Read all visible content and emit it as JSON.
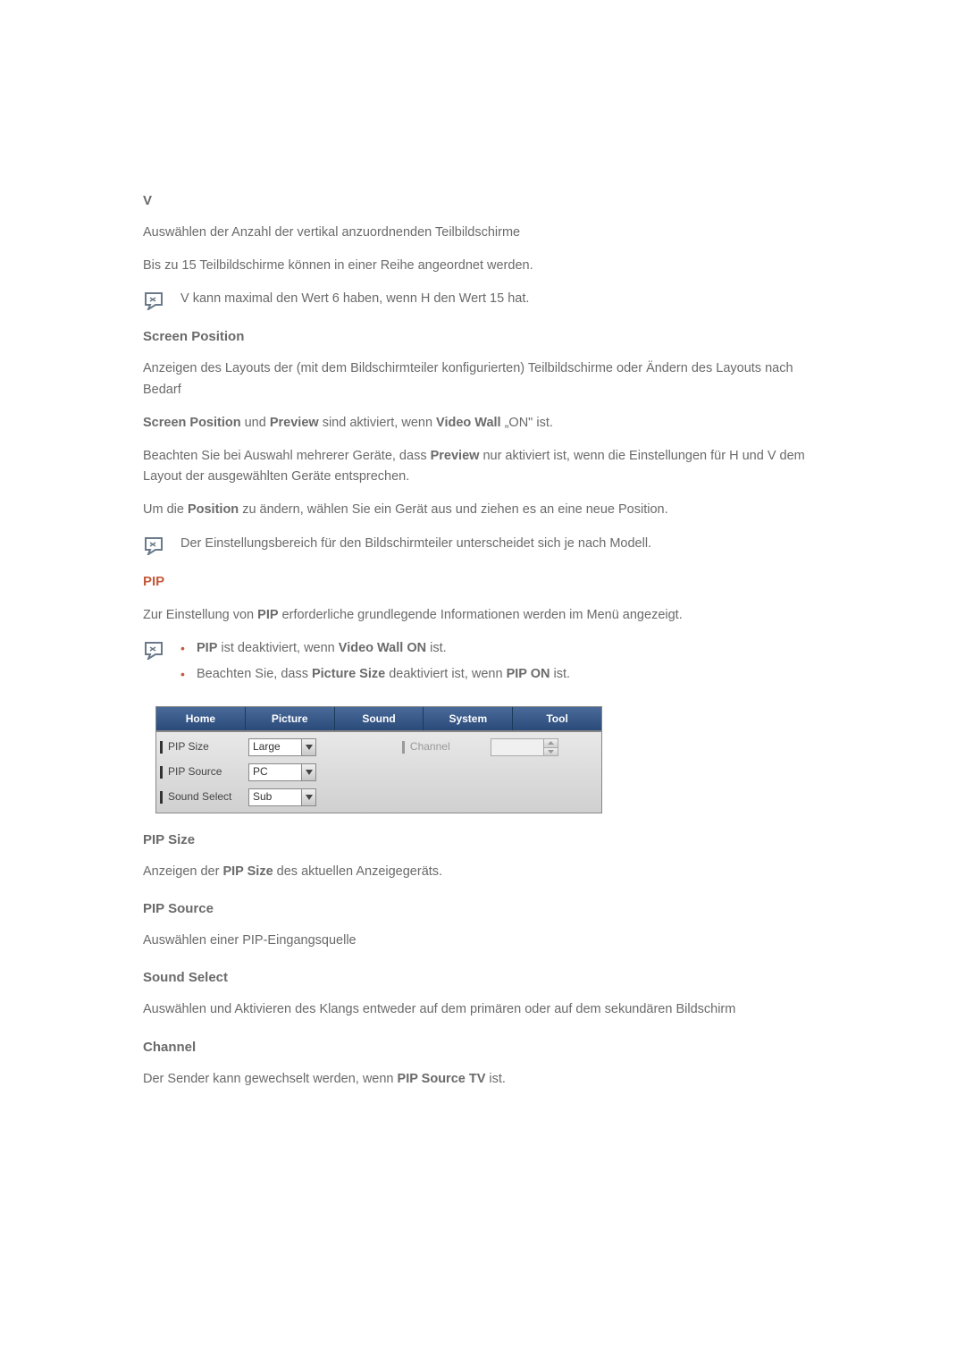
{
  "v": {
    "heading": "V",
    "p1": "Auswählen der Anzahl der vertikal anzuordnenden Teilbildschirme",
    "p2": "Bis zu 15 Teilbildschirme können in einer Reihe angeordnet werden.",
    "note": "V kann maximal den Wert 6 haben, wenn H den Wert 15 hat."
  },
  "screen_position": {
    "heading": "Screen Position",
    "p1": "Anzeigen des Layouts der (mit dem Bildschirmteiler konfigurierten) Teilbildschirme oder Ändern des Layouts nach Bedarf",
    "p2_1": "Screen Position",
    "p2_2": " und ",
    "p2_3": "Preview",
    "p2_4": " sind aktiviert, wenn ",
    "p2_5": "Video Wall",
    "p2_6": " „ON\" ist.",
    "p3_1": "Beachten Sie bei Auswahl mehrerer Geräte, dass ",
    "p3_2": "Preview",
    "p3_3": " nur aktiviert ist, wenn die Einstellungen für H und V dem Layout der ausgewählten Geräte entsprechen.",
    "p4_1": "Um die ",
    "p4_2": "Position",
    "p4_3": " zu ändern, wählen Sie ein Gerät aus und ziehen es an eine neue Position.",
    "note": "Der Einstellungsbereich für den Bildschirmteiler unterscheidet sich je nach Modell."
  },
  "pip": {
    "title": "PIP",
    "p1_1": "Zur Einstellung von ",
    "p1_2": "PIP",
    "p1_3": " erforderliche grundlegende Informationen werden im Menü angezeigt.",
    "bullet1_1": "PIP",
    "bullet1_2": " ist deaktiviert, wenn ",
    "bullet1_3": "Video Wall ON",
    "bullet1_4": " ist.",
    "bullet2_1": "Beachten Sie, dass ",
    "bullet2_2": "Picture Size",
    "bullet2_3": " deaktiviert ist, wenn ",
    "bullet2_4": "PIP ON",
    "bullet2_5": " ist."
  },
  "panel": {
    "tabs": [
      "Home",
      "Picture",
      "Sound",
      "System",
      "Tool"
    ],
    "rows": {
      "pip_size": {
        "label": "PIP Size",
        "value": "Large"
      },
      "pip_source": {
        "label": "PIP Source",
        "value": "PC"
      },
      "sound_select": {
        "label": "Sound Select",
        "value": "Sub"
      },
      "channel": {
        "label": "Channel",
        "value": ""
      }
    }
  },
  "pip_size": {
    "heading": "PIP Size",
    "p_1": "Anzeigen der ",
    "p_2": "PIP Size",
    "p_3": " des aktuellen Anzeigegeräts."
  },
  "pip_source": {
    "heading": "PIP Source",
    "p": "Auswählen einer PIP-Eingangsquelle"
  },
  "sound_select": {
    "heading": "Sound Select",
    "p": "Auswählen und Aktivieren des Klangs entweder auf dem primären oder auf dem sekundären Bildschirm"
  },
  "channel": {
    "heading": "Channel",
    "p_1": "Der Sender kann gewechselt werden, wenn ",
    "p_2": "PIP Source TV",
    "p_3": " ist."
  }
}
